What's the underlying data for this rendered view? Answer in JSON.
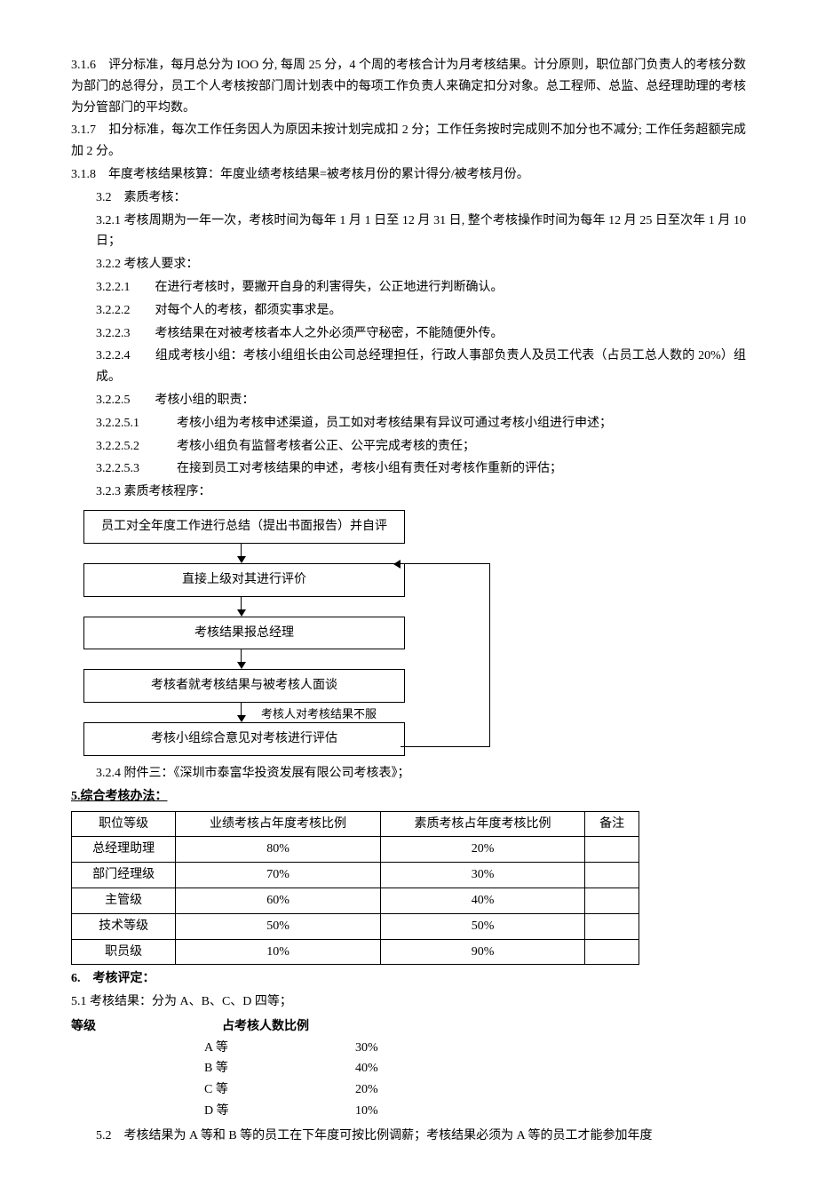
{
  "p316": "3.1.6　评分标准，每月总分为 IOO 分, 每周 25 分，4 个周的考核合计为月考核结果。计分原则，职位部门负责人的考核分数为部门的总得分，员工个人考核按部门周计划表中的每项工作负责人来确定扣分对象。总工程师、总监、总经理助理的考核为分管部门的平均数。",
  "p317": "3.1.7　扣分标准，每次工作任务因人为原因未按计划完成扣 2 分；工作任务按时完成则不加分也不减分; 工作任务超额完成加 2 分。",
  "p318": "3.1.8　年度考核结果核算：年度业绩考核结果=被考核月份的累计得分/被考核月份。",
  "p32": "3.2　素质考核：",
  "p321": "3.2.1 考核周期为一年一次，考核时间为每年 1 月 1 日至 12 月 31 日, 整个考核操作时间为每年 12 月 25 日至次年 1 月 10 日；",
  "p322": "3.2.2 考核人要求：",
  "p3221": "3.2.2.1　　在进行考核时，要撇开自身的利害得失，公正地进行判断确认。",
  "p3222": "3.2.2.2　　对每个人的考核，都须实事求是。",
  "p3223": "3.2.2.3　　考核结果在对被考核者本人之外必须严守秘密，不能随便外传。",
  "p3224": "3.2.2.4　　组成考核小组：考核小组组长由公司总经理担任，行政人事部负责人及员工代表（占员工总人数的 20%）组成。",
  "p3225": "3.2.2.5　　考核小组的职责：",
  "p32251": "3.2.2.5.1　　　考核小组为考核申述渠道，员工如对考核结果有异议可通过考核小组进行申述；",
  "p32252": "3.2.2.5.2　　　考核小组负有监督考核者公正、公平完成考核的责任；",
  "p32253": "3.2.2.5.3　　　在接到员工对考核结果的申述，考核小组有责任对考核作重新的评估；",
  "p323": "3.2.3 素质考核程序：",
  "flow": {
    "b1": "员工对全年度工作进行总结（提出书面报告）并自评",
    "b2": "直接上级对其进行评价",
    "b3": "考核结果报总经理",
    "b4": "考核者就考核结果与被考核人面谈",
    "b5": "考核小组综合意见对考核进行评估",
    "label45": "考核人对考核结果不服"
  },
  "p324": "3.2.4 附件三：《深圳市泰富华投资发展有限公司考核表》；",
  "h5": "5.综合考核办法：",
  "table5": {
    "headers": [
      "职位等级",
      "业绩考核占年度考核比例",
      "素质考核占年度考核比例",
      "备注"
    ],
    "rows": [
      [
        "总经理助理",
        "80%",
        "20%",
        ""
      ],
      [
        "部门经理级",
        "70%",
        "30%",
        ""
      ],
      [
        "主管级",
        "60%",
        "40%",
        ""
      ],
      [
        "技术等级",
        "50%",
        "50%",
        ""
      ],
      [
        "职员级",
        "10%",
        "90%",
        ""
      ]
    ]
  },
  "h6": "6.　考核评定：",
  "p51": "5.1 考核结果：分为 A、B、C、D 四等；",
  "gradeHeader": {
    "c1": "等级",
    "c2": "占考核人数比例"
  },
  "grades": [
    {
      "g": "A 等",
      "p": "30%"
    },
    {
      "g": "B 等",
      "p": "40%"
    },
    {
      "g": "C 等",
      "p": "20%"
    },
    {
      "g": "D 等",
      "p": "10%"
    }
  ],
  "p52": "5.2　考核结果为 A 等和 B 等的员工在下年度可按比例调薪；考核结果必须为 A 等的员工才能参加年度"
}
